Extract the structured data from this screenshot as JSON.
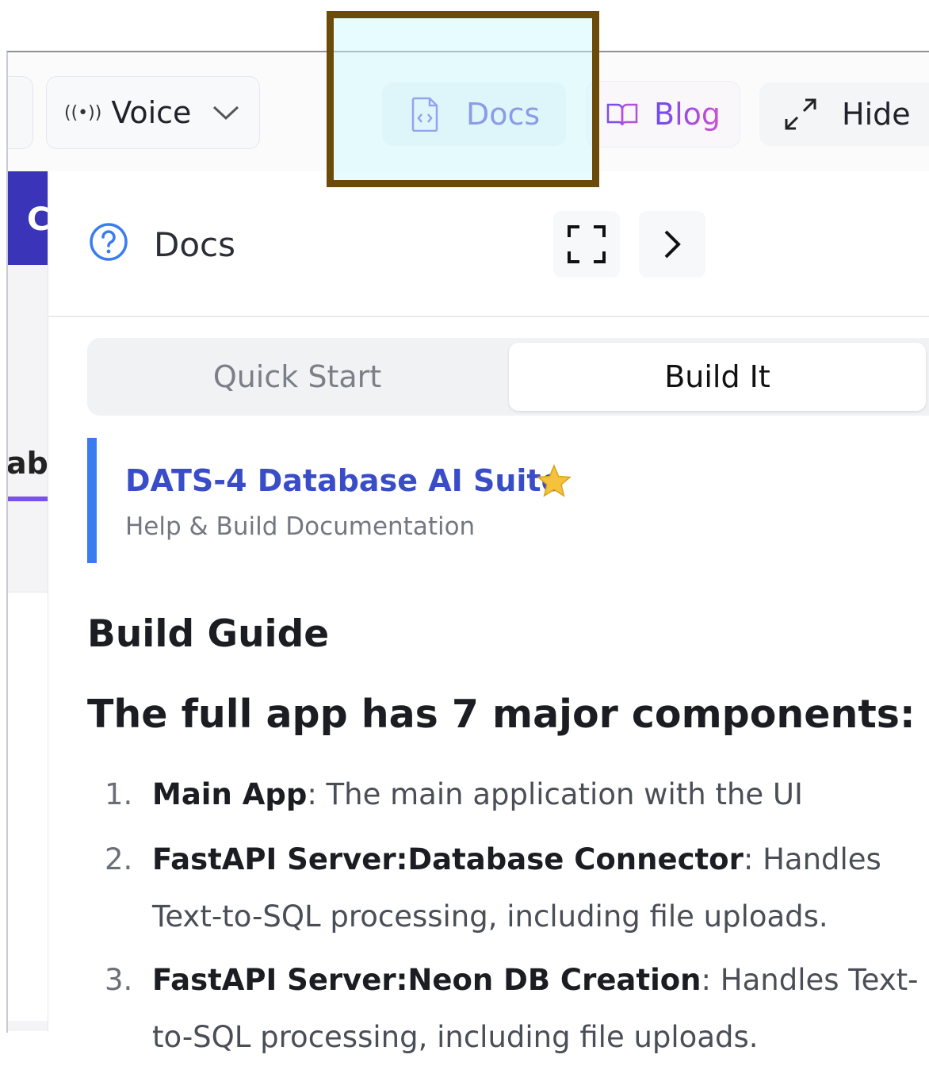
{
  "toolbar": {
    "voice_label": "Voice",
    "docs_label": "Docs",
    "blog_label": "Blog",
    "hide_label": "Hide"
  },
  "sidebar": {
    "badge_text": "C",
    "tab_fragment": "aba"
  },
  "panel": {
    "title": "Docs",
    "tabs": [
      {
        "label": "Quick Start",
        "active": false
      },
      {
        "label": "Build It",
        "active": true
      }
    ],
    "banner": {
      "title": "DATS-4 Database AI Suite",
      "subtitle": "Help & Build Documentation"
    },
    "heading": "Build Guide",
    "subheading": "The full app has 7 major components:",
    "items": [
      {
        "num": "1.",
        "name": "Main App",
        "desc": ": The main application with the UI"
      },
      {
        "num": "2.",
        "name": "FastAPI Server:Database Connector",
        "desc": ": Handles Text-to-SQL processing, including file uploads."
      },
      {
        "num": "3.",
        "name": "FastAPI Server:Neon DB Creation",
        "desc": ": Handles Text-to-SQL processing, including file uploads."
      }
    ]
  },
  "colors": {
    "accent_blue": "#3a7cf0",
    "banner_title": "#3a4dc9",
    "sidebar_badge": "#3a35b8",
    "highlight_border": "#6b4a0a"
  }
}
